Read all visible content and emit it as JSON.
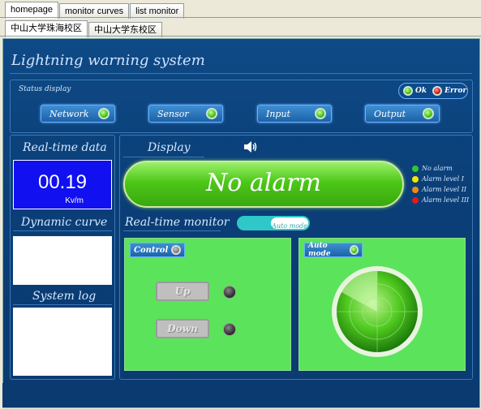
{
  "top_tabs": [
    "homepage",
    "monitor curves",
    "list monitor"
  ],
  "sub_tabs": [
    "中山大学珠海校区",
    "中山大学东校区"
  ],
  "app_title": "Lightning warning system",
  "status": {
    "title": "Status display",
    "ok_label": "Ok",
    "error_label": "Error",
    "buttons": [
      "Network",
      "Sensor",
      "Input",
      "Output"
    ]
  },
  "realtime": {
    "title": "Real-time data",
    "value": "00.19",
    "unit": "Kv/m"
  },
  "dynamic_curve_title": "Dynamic curve",
  "system_log_title": "System log",
  "display": {
    "title": "Display",
    "alarm_text": "No alarm"
  },
  "legend": [
    {
      "label": "No alarm",
      "color": "#2ec82e"
    },
    {
      "label": "Alarm level I",
      "color": "#f2e600"
    },
    {
      "label": "Alarm level II",
      "color": "#f08a12"
    },
    {
      "label": "Alarm level III",
      "color": "#e01a1a"
    }
  ],
  "monitor": {
    "title": "Real-time monitor",
    "mode_toggle": "Auto mode",
    "control_label": "Control",
    "up_label": "Up",
    "down_label": "Down",
    "auto_mode_label": "Auto mode"
  },
  "colors": {
    "panel_bg": "#0b3f78",
    "accent_green": "#5be35b",
    "value_bg": "#1010f0"
  }
}
